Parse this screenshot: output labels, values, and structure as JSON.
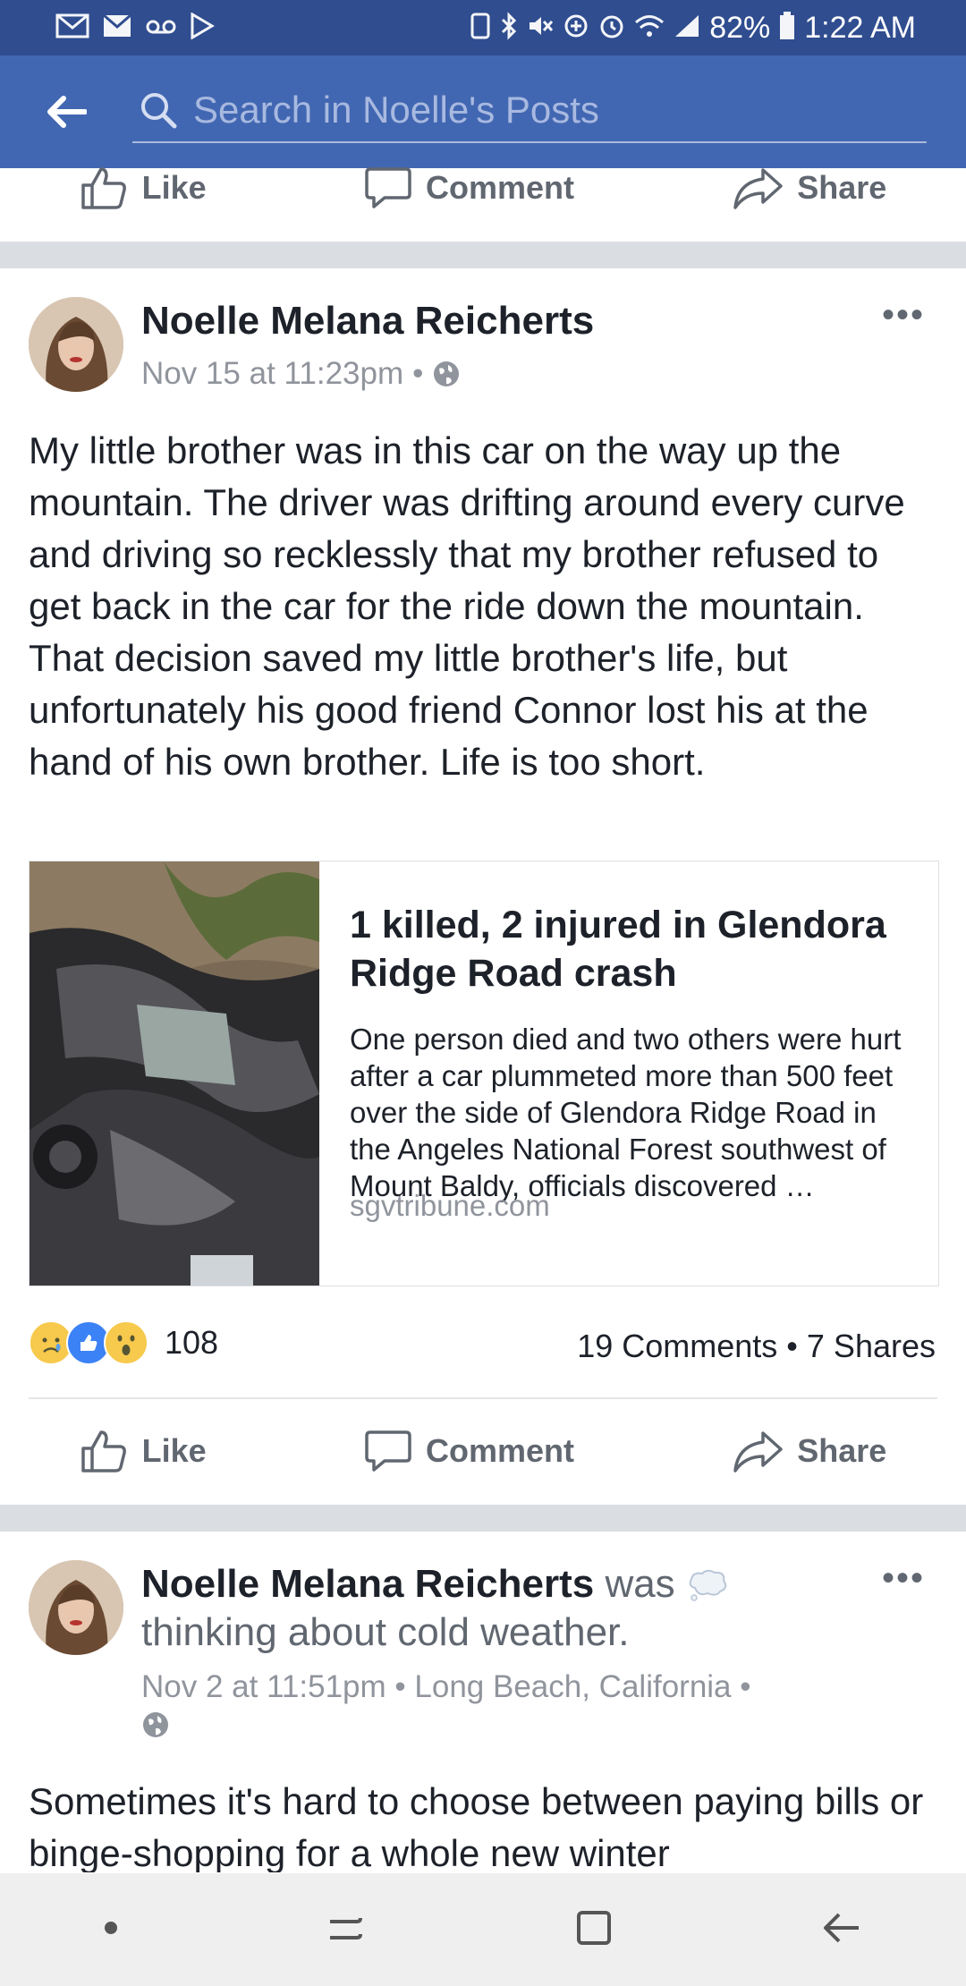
{
  "status_bar": {
    "battery": "82%",
    "time": "1:22 AM",
    "left_icons": [
      "gmail-icon",
      "mail-icon",
      "voicemail-icon",
      "play-store-icon"
    ],
    "right_icons": [
      "nfc-icon",
      "bluetooth-icon",
      "mute-icon",
      "data-saver-icon",
      "alarm-icon",
      "wifi-icon",
      "signal-icon",
      "battery-icon"
    ]
  },
  "header": {
    "search_placeholder": "Search in Noelle's Posts"
  },
  "actions": {
    "like": "Like",
    "comment": "Comment",
    "share": "Share"
  },
  "post1": {
    "author": "Noelle Melana Reicherts",
    "timestamp": "Nov 15 at 11:23pm",
    "audience_icon": "globe-icon",
    "body": "My little brother was in this car on the way up the mountain. The driver was drifting around every curve and driving so recklessly that my brother refused to get back in the car for the ride down the mountain. That decision saved my little brother's life, but unfortunately his good friend Connor lost his at the hand of his own brother. Life is too short.",
    "link": {
      "title": "1 killed, 2 injured in Glendora Ridge Road crash",
      "description": "One person died and two others were hurt after a car plummeted more than 500 feet over the side of Glendora Ridge Road in the Angeles National Forest southwest of Mount Baldy, officials discovered …",
      "source": "sgvtribune.com"
    },
    "reactions": {
      "count": "108",
      "types": [
        "sad",
        "like",
        "wow"
      ]
    },
    "comments": "19 Comments",
    "shares": "7 Shares"
  },
  "post2": {
    "author": "Noelle Melana Reicherts",
    "activity_was": "was",
    "activity": "thinking about cold weather.",
    "timestamp": "Nov 2 at 11:51pm",
    "location": "Long Beach, California",
    "body": "Sometimes it's hard to choose between paying bills or binge-shopping for a whole new winter"
  },
  "colors": {
    "statusbar": "#2f4d8f",
    "appbar": "#4267b2",
    "separator": "#dadde1",
    "secondary_text": "#90949c"
  }
}
